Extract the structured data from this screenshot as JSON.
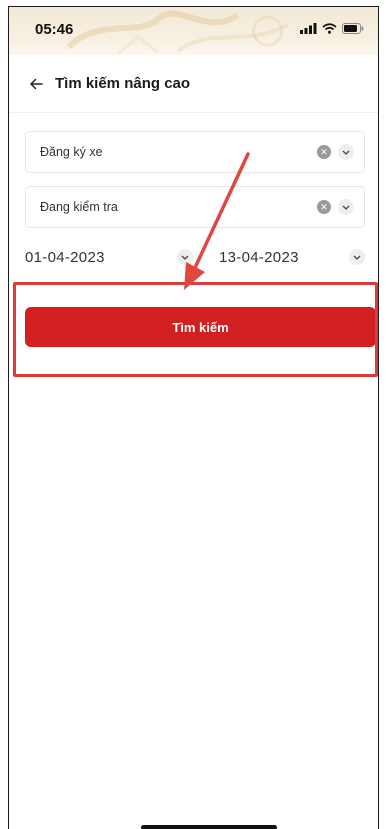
{
  "status_bar": {
    "time": "05:46",
    "icons": [
      "signal-icon",
      "wifi-icon",
      "battery-icon"
    ]
  },
  "header": {
    "back_icon": "arrow-left-icon",
    "title": "Tìm kiếm nâng cao"
  },
  "filters": {
    "type": {
      "label": "Đăng ký xe"
    },
    "status": {
      "label": "Đang kiểm tra"
    }
  },
  "date_range": {
    "from": "01-04-2023",
    "to": "13-04-2023"
  },
  "search_button": {
    "label": "Tìm kiếm"
  },
  "colors": {
    "primary_red": "#d11f22",
    "annotation_red": "#dd3b3b",
    "header_bg": "#f3e9d6"
  }
}
